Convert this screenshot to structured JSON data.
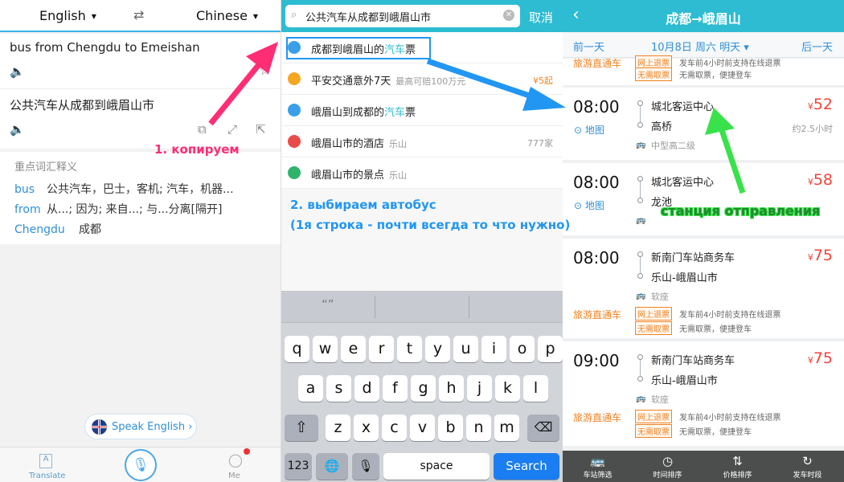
{
  "panel1": {
    "source_lang": "English",
    "target_lang": "Chinese",
    "swap_glyph": "⇄",
    "source_text": "bus from Chengdu to Emeishan",
    "translation": "公共汽车从成都到峨眉山市",
    "vocab_title": "重点词汇释义",
    "vocab": [
      {
        "word": "bus",
        "def": "公共汽车，巴士，客机; 汽车，机器..."
      },
      {
        "word": "from",
        "def": "从...; 因为; 来自...; 与...分离[隔开]"
      },
      {
        "word": "Chengdu",
        "def": "成都"
      }
    ],
    "speak_label": "Speak English",
    "tabs": {
      "translate": "Translate",
      "me": "Me"
    }
  },
  "panel2": {
    "query": "公共汽车从成都到峨眉山市",
    "cancel": "取消",
    "suggestions": [
      {
        "pre": "成都到峨眉山的",
        "hl": "汽车",
        "post": "票",
        "sub": "",
        "right": "",
        "icon_color": "#3a9ee8"
      },
      {
        "pre": "平安交通意外7天",
        "hl": "",
        "post": "",
        "sub": "最高可赔100万元",
        "right": "¥5起",
        "icon_color": "#f5a623"
      },
      {
        "pre": "峨眉山到成都的",
        "hl": "汽车",
        "post": "票",
        "sub": "",
        "right": "",
        "icon_color": "#3a9ee8"
      },
      {
        "pre": "峨眉山市的酒店",
        "hl": "",
        "post": "",
        "sub": "乐山",
        "right": "777家",
        "icon_color": "#e94b4b"
      },
      {
        "pre": "峨眉山市的景点",
        "hl": "",
        "post": "",
        "sub": "乐山",
        "right": "",
        "icon_color": "#2fb36b"
      }
    ],
    "prediction": "“”",
    "rows": [
      [
        "q",
        "w",
        "e",
        "r",
        "t",
        "y",
        "u",
        "i",
        "o",
        "p"
      ],
      [
        "a",
        "s",
        "d",
        "f",
        "g",
        "h",
        "j",
        "k",
        "l"
      ],
      [
        "z",
        "x",
        "c",
        "v",
        "b",
        "n",
        "m"
      ]
    ],
    "key_123": "123",
    "key_space": "space",
    "key_search": "Search"
  },
  "panel3": {
    "title": "成都→峨眉山",
    "prev_day": "前一天",
    "date": "10月8日 周六 明天 ▾",
    "next_day": "后一天",
    "map_label": "地图",
    "top_tag": "旅游直通车",
    "top_badge": "网上退票",
    "top_badge2": "无需取票",
    "top_txt": "发车前4小时前支持在线退票",
    "top_txt2": "无需取票，便捷登车",
    "trips": [
      {
        "time": "08:00",
        "from": "城北客运中心",
        "to": "高桥",
        "cls": "中型高二级",
        "price": "52",
        "dur": "约2.5小时",
        "map": true,
        "tag": ""
      },
      {
        "time": "08:00",
        "from": "城北客运中心",
        "to": "龙池",
        "cls": "",
        "price": "58",
        "dur": "",
        "map": true,
        "tag": ""
      },
      {
        "time": "08:00",
        "from": "新南门车站商务车",
        "to": "乐山-峨眉山市",
        "cls": "软座",
        "price": "75",
        "dur": "",
        "map": false,
        "tag": "旅游直通车"
      },
      {
        "time": "09:00",
        "from": "新南门车站商务车",
        "to": "乐山-峨眉山市",
        "cls": "软座",
        "price": "75",
        "dur": "",
        "map": false,
        "tag": "旅游直通车"
      }
    ],
    "badge_refund": "网上退票",
    "badge_noticket": "无需取票",
    "refund_txt": "发车前4小时前支持在线退票",
    "noticket_txt": "无需取票，便捷登车",
    "bottom_tabs": [
      {
        "label": "车站筛选",
        "icon": "🚌"
      },
      {
        "label": "时间排序",
        "icon": "◷"
      },
      {
        "label": "价格排序",
        "icon": "⇅"
      },
      {
        "label": "发车时段",
        "icon": "↻"
      }
    ]
  },
  "annotations": {
    "a1": "1. копируем",
    "a2": "2. выбираем автобус",
    "a2b": "(1я строка - почти всегда то что нужно)",
    "a3": "станция отправления"
  },
  "colors": {
    "accent": "#2dbcd1",
    "price": "#f0433a",
    "pink_arrow": "#ff2d73",
    "blue_arrow": "#2196f3",
    "green_arrow": "#39e24a"
  }
}
